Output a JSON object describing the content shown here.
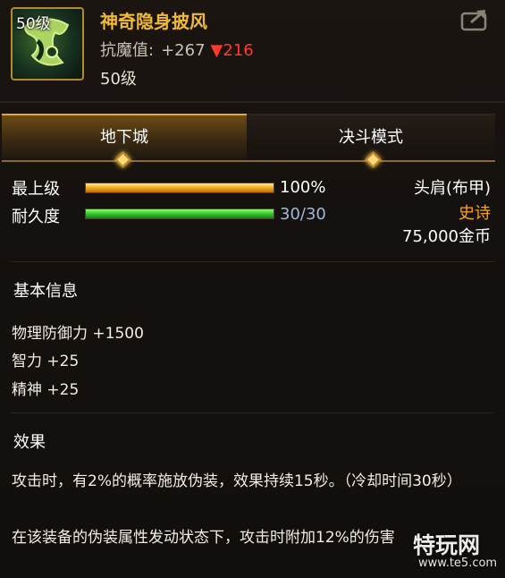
{
  "item": {
    "level_badge": "50级",
    "name": "神奇隐身披风",
    "stat_label": "抗魔值:",
    "stat_value": "+267",
    "stat_diff": "▼216",
    "required_level": "50级"
  },
  "tabs": [
    {
      "label": "地下城",
      "active": true
    },
    {
      "label": "决斗模式",
      "active": false
    }
  ],
  "bars": [
    {
      "label": "最上级",
      "value": "100%",
      "fraction": 1.0
    },
    {
      "label": "耐久度",
      "value": "30/30",
      "fraction": 1.0
    }
  ],
  "meta": {
    "slot": "头肩(布甲)",
    "rarity": "史诗",
    "price": "75,000金币"
  },
  "basic_info": {
    "title": "基本信息",
    "attributes": [
      "物理防御力 +1500",
      "智力 +25",
      "精神 +25"
    ]
  },
  "effect": {
    "title": "效果",
    "lines": [
      "攻击时，有2%的概率施放伪装，效果持续15秒。（冷却时间30秒）",
      "在该装备的伪装属性发动状态下，攻击时附加12%的伤害"
    ]
  },
  "watermark": {
    "text": "特玩网",
    "site": "www.te5.com"
  },
  "colors": {
    "title": "#f1b93a",
    "rarity": "#ffa31a",
    "down": "#ff3a2a"
  },
  "icons": {
    "share": "share-icon",
    "item": "cloak-item-icon"
  }
}
